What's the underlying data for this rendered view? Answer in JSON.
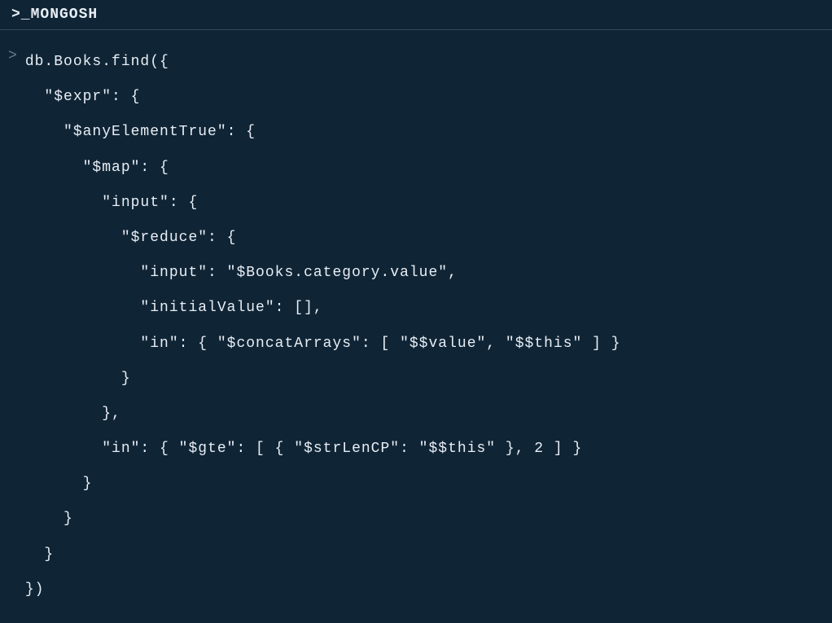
{
  "header": {
    "title": ">_MONGOSH"
  },
  "prompt": {
    "chevron": ">"
  },
  "code": {
    "line0": "db.Books.find({",
    "line1": "  \"$expr\": {",
    "line2": "    \"$anyElementTrue\": {",
    "line3": "      \"$map\": {",
    "line4": "        \"input\": {",
    "line5": "          \"$reduce\": {",
    "line6": "            \"input\": \"$Books.category.value\",",
    "line7": "            \"initialValue\": [],",
    "line8": "            \"in\": { \"$concatArrays\": [ \"$$value\", \"$$this\" ] }",
    "line9": "          }",
    "line10": "        },",
    "line11": "        \"in\": { \"$gte\": [ { \"$strLenCP\": \"$$this\" }, 2 ] }",
    "line12": "      }",
    "line13": "    }",
    "line14": "  }",
    "line15": "})"
  }
}
